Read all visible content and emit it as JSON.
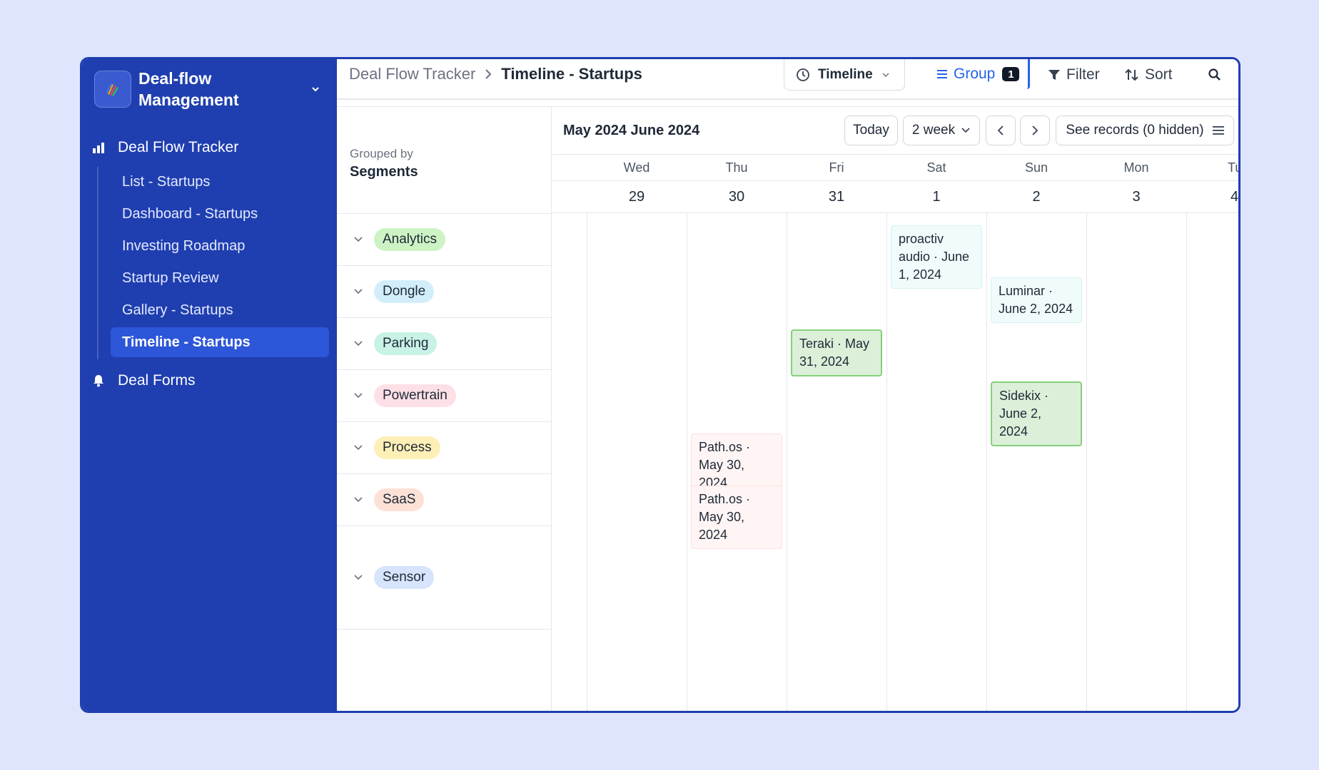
{
  "app": {
    "title": "Deal-flow Management"
  },
  "sidebar": {
    "section_main": "Deal Flow Tracker",
    "items": [
      {
        "label": "List - Startups"
      },
      {
        "label": "Dashboard - Startups"
      },
      {
        "label": "Investing Roadmap"
      },
      {
        "label": "Startup Review"
      },
      {
        "label": "Gallery - Startups"
      },
      {
        "label": "Timeline - Startups"
      }
    ],
    "section_forms": "Deal Forms"
  },
  "breadcrumb": {
    "parent": "Deal Flow Tracker",
    "current": "Timeline - Startups"
  },
  "toolbar": {
    "view": "Timeline",
    "group": "Group",
    "group_count": "1",
    "filter": "Filter",
    "sort": "Sort"
  },
  "group_panel": {
    "grouped_by_label": "Grouped by",
    "grouped_by_value": "Segments",
    "groups": [
      {
        "label": "Analytics",
        "color": "#cdf3c4"
      },
      {
        "label": "Dongle",
        "color": "#d2eefb"
      },
      {
        "label": "Parking",
        "color": "#c8f2e6"
      },
      {
        "label": "Powertrain",
        "color": "#fde0e6"
      },
      {
        "label": "Process",
        "color": "#fdefb6"
      },
      {
        "label": "SaaS",
        "color": "#fde1d6"
      },
      {
        "label": "Sensor",
        "color": "#d6e4fc"
      }
    ]
  },
  "timeline": {
    "month_label": "May 2024 June 2024",
    "today": "Today",
    "range": "2 week",
    "see_records": "See records (0 hidden)",
    "days": [
      {
        "name": "Wed",
        "date": "29"
      },
      {
        "name": "Thu",
        "date": "30"
      },
      {
        "name": "Fri",
        "date": "31"
      },
      {
        "name": "Sat",
        "date": "1"
      },
      {
        "name": "Sun",
        "date": "2"
      },
      {
        "name": "Mon",
        "date": "3"
      },
      {
        "name": "Tu",
        "date": "4"
      }
    ],
    "cards": [
      {
        "text": "proactiv audio · June 1, 2024"
      },
      {
        "text": "Luminar · June 2, 2024"
      },
      {
        "text": "Teraki · May 31, 2024"
      },
      {
        "text": "Sidekix · June 2, 2024"
      },
      {
        "text": "Path.os · May 30, 2024"
      },
      {
        "text": "Path.os · May 30, 2024"
      }
    ]
  }
}
